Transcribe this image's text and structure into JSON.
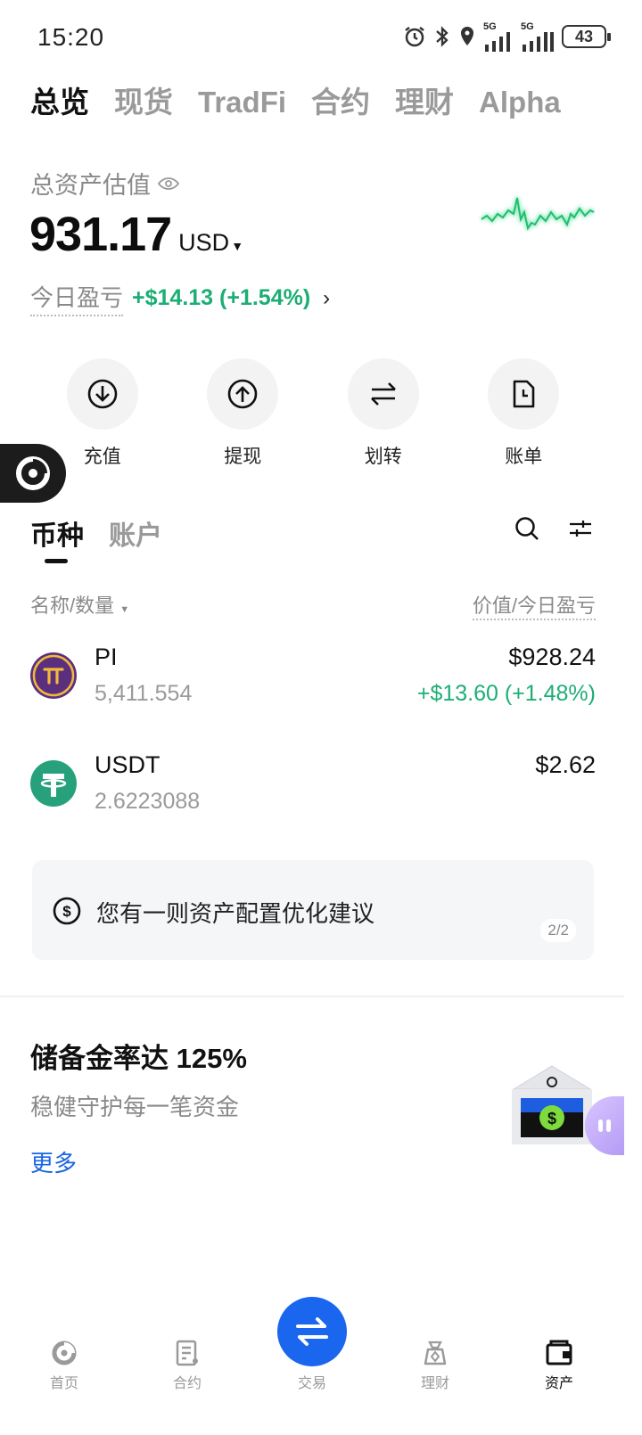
{
  "status_bar": {
    "time": "15:20",
    "network1": "5G",
    "network2": "5G",
    "battery": "43"
  },
  "top_tabs": [
    "总览",
    "现货",
    "TradFi",
    "合约",
    "理财",
    "Alpha"
  ],
  "overview": {
    "total_label": "总资产估值",
    "total_value": "931.17",
    "currency": "USD",
    "pnl_label": "今日盈亏",
    "pnl_value": "+$14.13 (+1.54%)"
  },
  "actions": [
    {
      "label": "充值",
      "icon": "deposit-icon"
    },
    {
      "label": "提现",
      "icon": "withdraw-icon"
    },
    {
      "label": "划转",
      "icon": "transfer-icon"
    },
    {
      "label": "账单",
      "icon": "bill-icon"
    }
  ],
  "asset_tabs": [
    "币种",
    "账户"
  ],
  "list_header": {
    "left": "名称/数量",
    "right": "价值/今日盈亏"
  },
  "coins": [
    {
      "name": "PI",
      "quantity": "5,411.554",
      "value": "$928.24",
      "pnl": "+$13.60 (+1.48%)"
    },
    {
      "name": "USDT",
      "quantity": "2.6223088",
      "value": "$2.62",
      "pnl": ""
    }
  ],
  "suggestion": {
    "text": "您有一则资产配置优化建议",
    "page": "2/2"
  },
  "reserve": {
    "title": "储备金率达 125%",
    "subtitle": "稳健守护每一笔资金",
    "more": "更多"
  },
  "bottom_nav": [
    {
      "label": "首页",
      "icon": "home-icon"
    },
    {
      "label": "合约",
      "icon": "contract-icon"
    },
    {
      "label": "交易",
      "icon": "trade-icon"
    },
    {
      "label": "理财",
      "icon": "earn-icon"
    },
    {
      "label": "资产",
      "icon": "assets-icon"
    }
  ],
  "colors": {
    "accent_green": "#1cae74",
    "accent_blue": "#1a66ee",
    "link_blue": "#1a66e0"
  }
}
